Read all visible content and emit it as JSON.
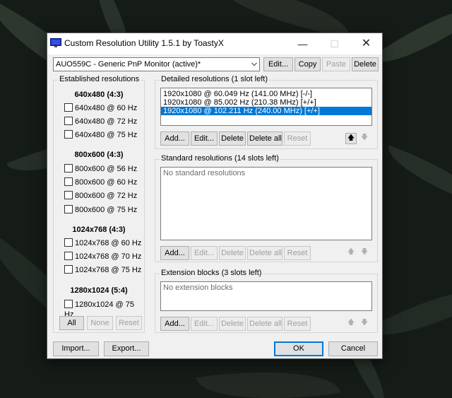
{
  "window": {
    "title": "Custom Resolution Utility 1.5.1 by ToastyX",
    "min_glyph": "—",
    "max_glyph": "☐",
    "close_glyph": "✕"
  },
  "monitor": {
    "selected": "AUO559C - Generic PnP Monitor (active)*",
    "edit_label": "Edit...",
    "copy_label": "Copy",
    "paste_label": "Paste",
    "delete_label": "Delete"
  },
  "established": {
    "title": "Established resolutions",
    "groups": [
      {
        "heading": "640x480 (4:3)",
        "items": [
          "640x480 @ 60 Hz",
          "640x480 @ 72 Hz",
          "640x480 @ 75 Hz"
        ]
      },
      {
        "heading": "800x600 (4:3)",
        "items": [
          "800x600 @ 56 Hz",
          "800x600 @ 60 Hz",
          "800x600 @ 72 Hz",
          "800x600 @ 75 Hz"
        ]
      },
      {
        "heading": "1024x768 (4:3)",
        "items": [
          "1024x768 @ 60 Hz",
          "1024x768 @ 70 Hz",
          "1024x768 @ 75 Hz"
        ]
      },
      {
        "heading": "1280x1024 (5:4)",
        "items": [
          "1280x1024 @ 75 Hz"
        ]
      }
    ],
    "all_label": "All",
    "none_label": "None",
    "reset_label": "Reset"
  },
  "detailed": {
    "title": "Detailed resolutions (1 slot left)",
    "items": [
      "1920x1080 @ 60.049 Hz (141.00 MHz) [-/-]",
      "1920x1080 @ 85.002 Hz (210.38 MHz) [+/+]",
      "1920x1080 @ 102.211 Hz (240.00 MHz) [+/+]"
    ],
    "selected_index": 2,
    "add_label": "Add...",
    "edit_label": "Edit...",
    "delete_label": "Delete",
    "delete_all_label": "Delete all",
    "reset_label": "Reset",
    "up_glyph": "🡅",
    "down_glyph": "🡇"
  },
  "standard": {
    "title": "Standard resolutions (14 slots left)",
    "empty_text": "No standard resolutions",
    "add_label": "Add...",
    "edit_label": "Edit...",
    "delete_label": "Delete",
    "delete_all_label": "Delete all",
    "reset_label": "Reset",
    "up_glyph": "🡅",
    "down_glyph": "🡇"
  },
  "extension": {
    "title": "Extension blocks (3 slots left)",
    "empty_text": "No extension blocks",
    "add_label": "Add...",
    "edit_label": "Edit...",
    "delete_label": "Delete",
    "delete_all_label": "Delete all",
    "reset_label": "Reset",
    "up_glyph": "🡅",
    "down_glyph": "🡇"
  },
  "footer": {
    "import_label": "Import...",
    "export_label": "Export...",
    "ok_label": "OK",
    "cancel_label": "Cancel"
  },
  "colors": {
    "accent": "#0078d7",
    "window_bg": "#f0f0f0"
  }
}
